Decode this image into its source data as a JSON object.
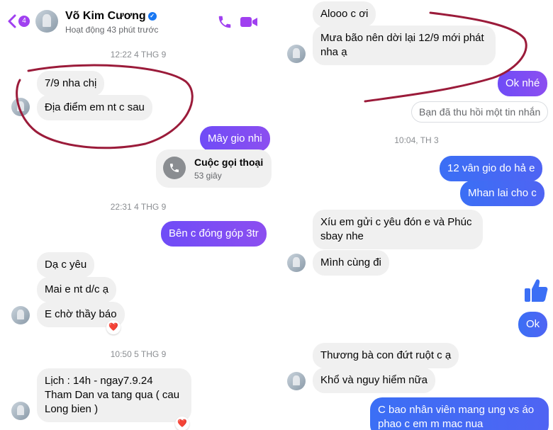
{
  "header": {
    "back_count": "4",
    "contact_name": "Võ Kim Cương",
    "status": "Hoạt động 43 phút trước"
  },
  "left": {
    "times": [
      "12:22 4 THG 9",
      "22:31 4 THG 9",
      "10:50 5 THG 9"
    ],
    "messages": [
      "7/9 nha chị",
      "Địa điểm em nt c sau",
      "Mây gio nhi",
      "Bên c đóng góp 3tr",
      "Dạ c yêu",
      "Mai e nt d/c ạ",
      "E chờ thầy báo",
      "Lịch : 14h - ngay7.9.24\nTham Dan va tang qua ( cau\nLong  bien )"
    ],
    "call": {
      "title": "Cuộc gọi thoại",
      "duration": "53 giây"
    },
    "reaction": "❤️"
  },
  "right": {
    "times": [
      "10:04, TH 3"
    ],
    "messages": [
      "Alooo c ơi",
      "Mưa bão nên dời lại 12/9 mới phát\nnha ạ",
      "Ok nhé",
      "12 vân gio do hả e",
      "Mhan lai cho c",
      "Xíu em gửi c yêu đón e và Phúc\nsbay nhe",
      "Mình cùng đi",
      "Ok",
      "Thương bà con đứt ruột c ạ",
      "Khổ và nguy hiểm nữa",
      "C bao nhân viên mang ung vs áo\nphao c em m mac nua"
    ],
    "recalled": "Bạn đã thu hồi một tin nhắn",
    "like_icon": "thumbs-up-icon"
  },
  "colors": {
    "outgoing_purple": "#7c4dff",
    "outgoing_blue": "#4a6cf4",
    "incoming": "#f0f0f0",
    "annotation": "#9b1b3a"
  }
}
